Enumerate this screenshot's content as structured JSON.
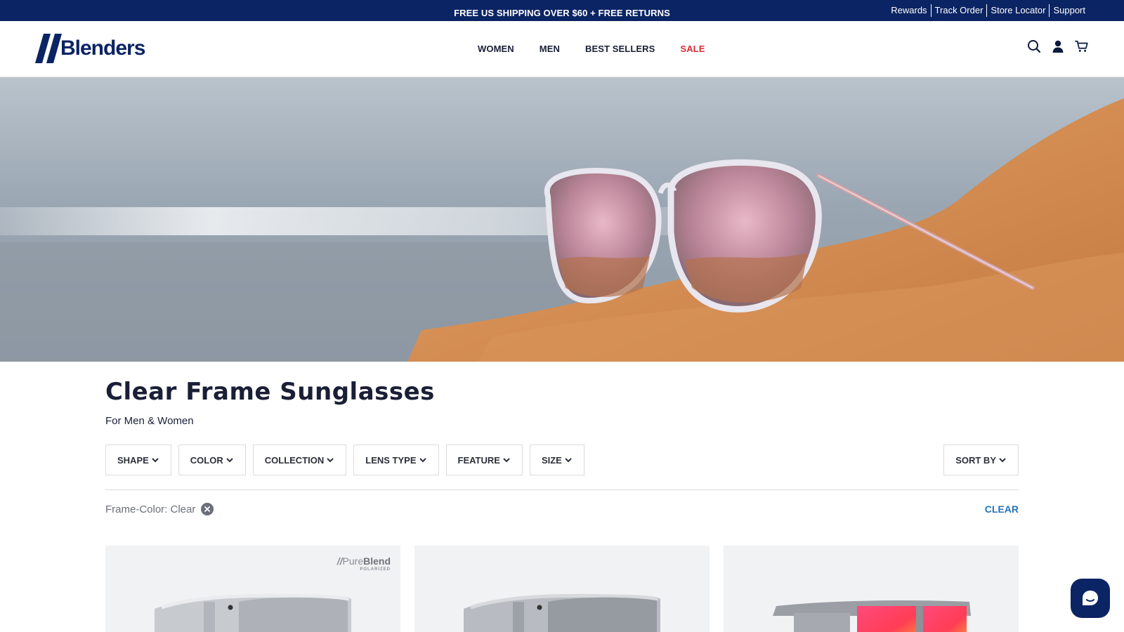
{
  "announcement": {
    "text": "FREE US SHIPPING OVER $60 + FREE RETURNS",
    "links": [
      "Rewards",
      "Track Order",
      "Store Locator",
      "Support"
    ]
  },
  "header": {
    "logo_text": "Blenders",
    "nav": [
      "WOMEN",
      "MEN",
      "BEST SELLERS",
      "SALE"
    ],
    "icons": [
      "search-icon",
      "account-icon",
      "cart-icon"
    ]
  },
  "page": {
    "title": "Clear Frame Sunglasses",
    "subtitle": "For Men & Women"
  },
  "filters": {
    "buttons": [
      "SHAPE",
      "COLOR",
      "COLLECTION",
      "LENS TYPE",
      "FEATURE",
      "SIZE"
    ],
    "sort_label": "SORT BY",
    "active": "Frame-Color: Clear",
    "clear_label": "CLEAR"
  },
  "products": {
    "badge_brand_light": "Pure",
    "badge_brand_bold": "Blend",
    "badge_sub": "POLARIZED"
  },
  "colors": {
    "navy": "#0b2463",
    "sale_red": "#d92b35",
    "link_blue": "#2574b5"
  }
}
